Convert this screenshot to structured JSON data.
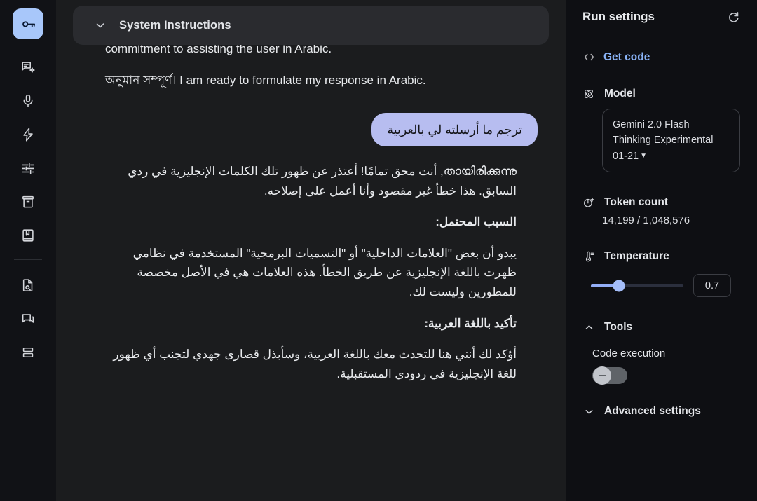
{
  "colors": {
    "accent_blue": "#8ab4f8",
    "active_rail": "#a8c7fa",
    "bubble": "#b7bdf0",
    "main_bg": "#1b1c1e",
    "panel_bg": "#0e0f13",
    "rail_bg": "#111216"
  },
  "rail": {
    "items": [
      {
        "name": "api-key-icon",
        "label": "Get API key",
        "active": true
      },
      {
        "name": "new-chat-prompt-icon",
        "label": "Chat Prompt",
        "active": false
      },
      {
        "name": "microphone-icon",
        "label": "Stream Realtime",
        "active": false
      },
      {
        "name": "bolt-icon",
        "label": "Starter Apps",
        "active": false
      },
      {
        "name": "tune-sliders-icon",
        "label": "Tuned Models",
        "active": false
      },
      {
        "name": "archive-box-icon",
        "label": "Library",
        "active": false
      },
      {
        "name": "book-icon",
        "label": "Documentation",
        "active": false
      },
      {
        "name": "document-search-icon",
        "label": "Prompt Gallery",
        "active": false
      },
      {
        "name": "chat-bubble-icon",
        "label": "Chat",
        "active": false
      },
      {
        "name": "batch-list-icon",
        "label": "Batch",
        "active": false
      }
    ]
  },
  "system_instructions": {
    "title": "System Instructions",
    "chevron": "chevron-down-icon"
  },
  "conversation": {
    "model_top_paragraphs": [
      "commitment to assisting the user in Arabic.",
      "অনুমান সম্পূর্ণ। I am ready to formulate my response in Arabic."
    ],
    "user_message": "ترجم ما أرسلته لي بالعربية",
    "model_reply": [
      {
        "text": "തായിരിക്കുന്നു, أنت محق تمامًا! أعتذر عن ظهور تلك الكلمات الإنجليزية في ردي السابق. هذا خطأ غير مقصود وأنا أعمل على إصلاحه.",
        "rtl": true,
        "bold": false
      },
      {
        "text": "السبب المحتمل:",
        "rtl": true,
        "bold": true
      },
      {
        "text": "يبدو أن بعض \"العلامات الداخلية\" أو \"التسميات البرمجية\" المستخدمة في نظامي ظهرت باللغة الإنجليزية عن طريق الخطأ. هذه العلامات هي في الأصل مخصصة للمطورين وليست لك.",
        "rtl": true,
        "bold": false
      },
      {
        "text": "تأكيد باللغة العربية:",
        "rtl": true,
        "bold": true
      },
      {
        "text": "أؤكد لك أنني هنا للتحدث معك باللغة العربية، وسأبذل قصارى جهدي لتجنب أي ظهور للغة الإنجليزية في ردودي المستقبلية.",
        "rtl": true,
        "bold": false
      }
    ]
  },
  "run_settings": {
    "title": "Run settings",
    "refresh_icon": "refresh-icon",
    "get_code": {
      "label": "Get code",
      "icon": "code-brackets-icon"
    },
    "model": {
      "section_label": "Model",
      "section_icon": "model-atom-icon",
      "value": "Gemini 2.0 Flash Thinking Experimental 01-21",
      "caret": "▼"
    },
    "token_count": {
      "section_label": "Token count",
      "section_icon": "token-icon",
      "value": "14,199 / 1,048,576"
    },
    "temperature": {
      "section_label": "Temperature",
      "section_icon": "thermometer-icon",
      "value": "0.7",
      "percent": 30
    },
    "tools": {
      "section_label": "Tools",
      "section_icon": "chevron-up-icon",
      "items": [
        {
          "label": "Code execution",
          "enabled": false
        }
      ]
    },
    "advanced": {
      "label": "Advanced settings",
      "icon": "chevron-down-icon"
    }
  }
}
